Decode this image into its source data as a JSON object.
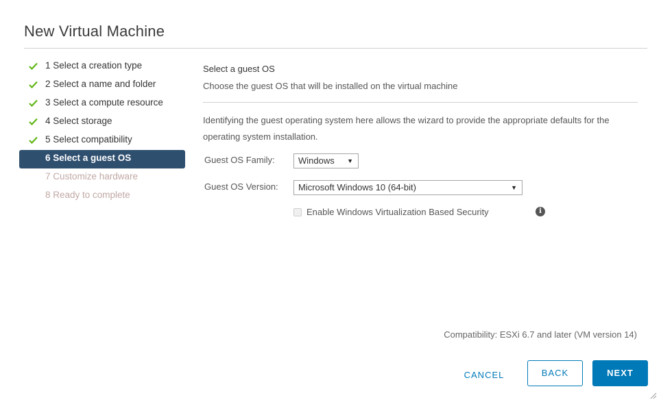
{
  "dialog": {
    "title": "New Virtual Machine"
  },
  "steps": [
    {
      "label": "1 Select a creation type",
      "state": "done"
    },
    {
      "label": "2 Select a name and folder",
      "state": "done"
    },
    {
      "label": "3 Select a compute resource",
      "state": "done"
    },
    {
      "label": "4 Select storage",
      "state": "done"
    },
    {
      "label": "5 Select compatibility",
      "state": "done"
    },
    {
      "label": "6 Select a guest OS",
      "state": "active"
    },
    {
      "label": "7 Customize hardware",
      "state": "pending"
    },
    {
      "label": "8 Ready to complete",
      "state": "pending"
    }
  ],
  "main": {
    "heading": "Select a guest OS",
    "subheading": "Choose the guest OS that will be installed on the virtual machine",
    "description": "Identifying the guest operating system here allows the wizard to provide the appropriate defaults for the operating system installation."
  },
  "form": {
    "family_label": "Guest OS Family:",
    "family_value": "Windows",
    "version_label": "Guest OS Version:",
    "version_value": "Microsoft Windows 10 (64-bit)",
    "vbs_label": "Enable Windows Virtualization Based Security",
    "vbs_checked": false
  },
  "footer": {
    "compatibility": "Compatibility: ESXi 6.7 and later (VM version 14)",
    "cancel_label": "CANCEL",
    "back_label": "BACK",
    "next_label": "NEXT"
  },
  "icons": {
    "check": "check-icon",
    "info": "info-icon",
    "caret": "caret-down-icon"
  },
  "colors": {
    "primary": "#0079b8",
    "active_step_bg": "#2f4f6f",
    "check_green": "#60b515",
    "pending_text": "#c0a8a4"
  }
}
